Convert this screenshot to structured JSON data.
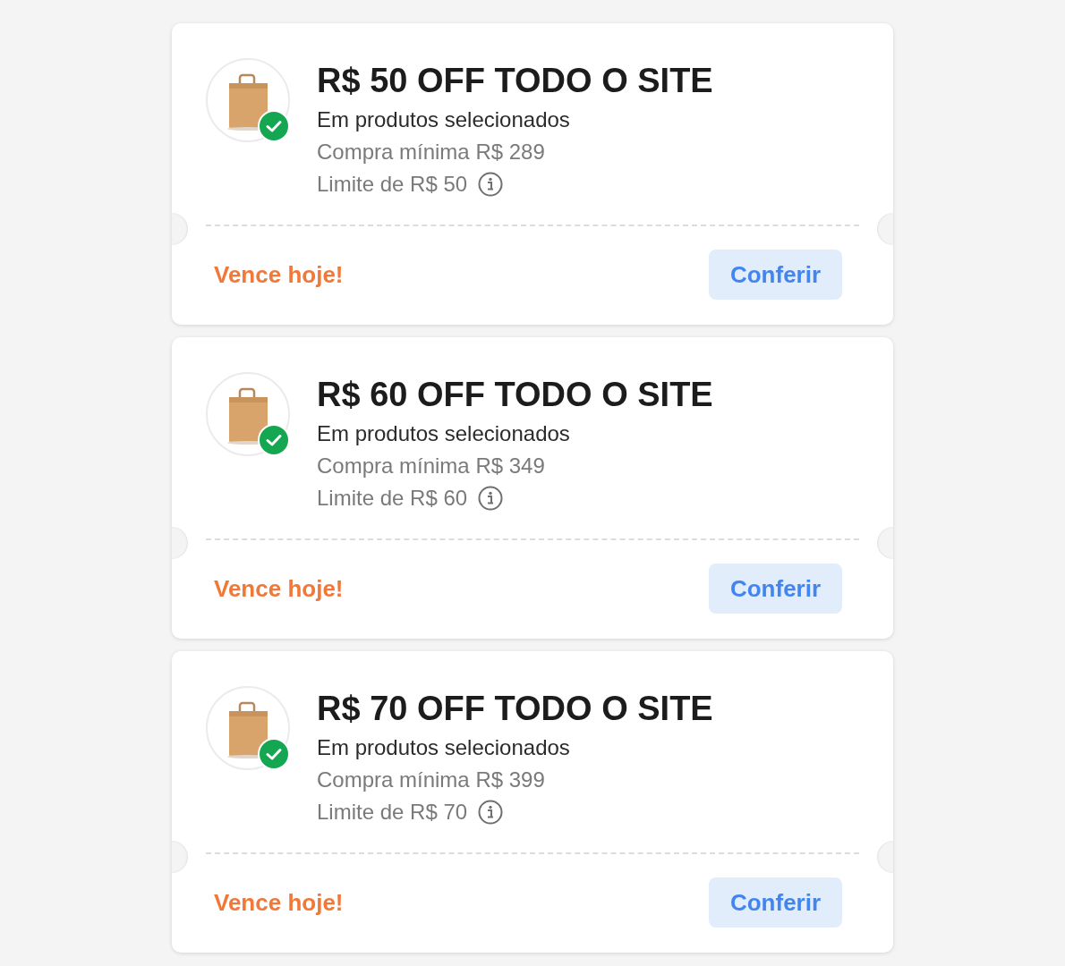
{
  "coupons": [
    {
      "title": "R$ 50 OFF TODO O SITE",
      "subtitle": "Em produtos selecionados",
      "min_purchase": "Compra mínima R$ 289",
      "limit": "Limite de R$ 50",
      "applied": true,
      "expiry": "Vence hoje!",
      "button": "Conferir"
    },
    {
      "title": "R$ 60 OFF TODO O SITE",
      "subtitle": "Em produtos selecionados",
      "min_purchase": "Compra mínima R$ 349",
      "limit": "Limite de R$ 60",
      "applied": true,
      "expiry": "Vence hoje!",
      "button": "Conferir"
    },
    {
      "title": "R$ 70 OFF TODO O SITE",
      "subtitle": "Em produtos selecionados",
      "min_purchase": "Compra mínima R$ 399",
      "limit": "Limite de R$ 70",
      "applied": true,
      "expiry": "Vence hoje!",
      "button": "Conferir"
    }
  ]
}
